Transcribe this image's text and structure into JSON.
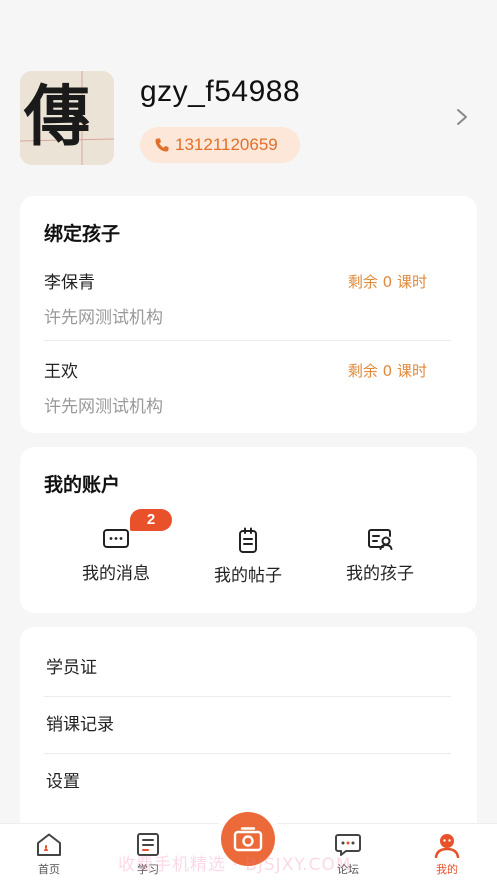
{
  "profile": {
    "username": "gzy_f54988",
    "phone": "13121120659",
    "avatar_glyph": "傳"
  },
  "bound_children": {
    "title": "绑定孩子",
    "children": [
      {
        "name": "李保青",
        "org": "许先网测试机构",
        "remaining": "剩余 0 课时"
      },
      {
        "name": "王欢",
        "org": "许先网测试机构",
        "remaining": "剩余 0 课时"
      }
    ]
  },
  "account": {
    "title": "我的账户",
    "items": [
      {
        "label": "我的消息",
        "icon": "message-icon",
        "badge": "2"
      },
      {
        "label": "我的帖子",
        "icon": "post-icon"
      },
      {
        "label": "我的孩子",
        "icon": "child-profile-icon"
      }
    ]
  },
  "menu": {
    "items": [
      "学员证",
      "销课记录",
      "设置"
    ]
  },
  "tabbar": {
    "tabs": [
      {
        "label": "首页",
        "icon": "home-icon"
      },
      {
        "label": "学习",
        "icon": "study-icon"
      },
      {
        "label": "论坛",
        "icon": "forum-icon"
      },
      {
        "label": "我的",
        "icon": "profile-icon",
        "active": true
      }
    ]
  },
  "watermark": "收费手机精选 · BJSJXY.COM",
  "colors": {
    "accent": "#e8512a",
    "orange_text": "#e08a3c",
    "pill_bg": "#fde7d8"
  }
}
